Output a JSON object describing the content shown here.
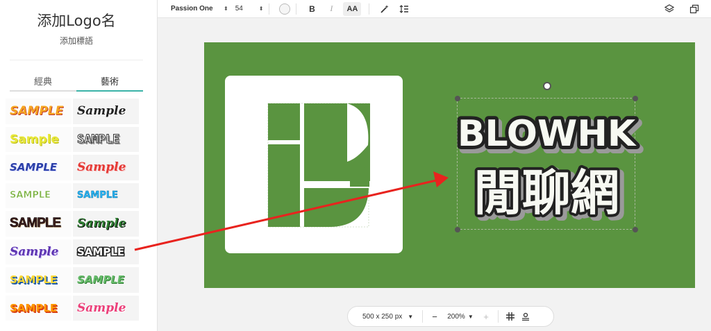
{
  "sidebar": {
    "title": "添加Logo名",
    "subtitle": "添加標語",
    "tabs": [
      {
        "label": "經典",
        "active": false
      },
      {
        "label": "藝術",
        "active": true
      }
    ],
    "samples": [
      {
        "label": "SAMPLE",
        "color": "#f5a623",
        "style": "bold-orange"
      },
      {
        "label": "Sample",
        "color": "#222222",
        "style": "script-dark"
      },
      {
        "label": "Sample",
        "color": "#e8e83a",
        "style": "bubble-yellow"
      },
      {
        "label": "SAMPLE",
        "color": "#ffffff",
        "style": "outline-gray"
      },
      {
        "label": "SAMPLE",
        "color": "#2b3fa8",
        "style": "italic-blue"
      },
      {
        "label": "Sample",
        "color": "#e53935",
        "style": "italic-red"
      },
      {
        "label": "SAMPLE",
        "color": "#7cb342",
        "style": "bold-green"
      },
      {
        "label": "SAMPLE",
        "color": "#29b6f6",
        "style": "bubble-cyan"
      },
      {
        "label": "SAMPLE",
        "color": "#3e1e1e",
        "style": "condensed-brown"
      },
      {
        "label": "Sample",
        "color": "#2e7d32",
        "style": "script-green"
      },
      {
        "label": "Sample",
        "color": "#5e35b1",
        "style": "script-purple"
      },
      {
        "label": "SAMPLE",
        "color": "#ffffff",
        "style": "block-black"
      },
      {
        "label": "SAMPLE",
        "color": "#fdd835",
        "style": "bold-yellow-blue"
      },
      {
        "label": "SAMPLE",
        "color": "#66bb6a",
        "style": "italic-green"
      },
      {
        "label": "SAMPLE",
        "color": "#ff9800",
        "style": "bold-orange-red"
      },
      {
        "label": "Sample",
        "color": "#ec407a",
        "style": "script-pink"
      }
    ]
  },
  "toolbar": {
    "font_name": "Passion One",
    "font_size": "54",
    "bold_label": "B",
    "italic_label": "I",
    "case_label": "AA",
    "icons": [
      "magic-icon",
      "line-spacing-icon",
      "layers-icon",
      "duplicate-icon"
    ]
  },
  "canvas": {
    "background_color": "#5a9440",
    "logo_box_color": "#ffffff",
    "logo_mark_color": "#5a9440",
    "headline": "BLOWHK",
    "tagline": "閒聊網"
  },
  "bottombar": {
    "size_label": "500 x 250 px",
    "zoom_label": "200%",
    "minus_label": "−",
    "plus_label": "+",
    "icons": [
      "grid-icon",
      "align-icon"
    ]
  }
}
